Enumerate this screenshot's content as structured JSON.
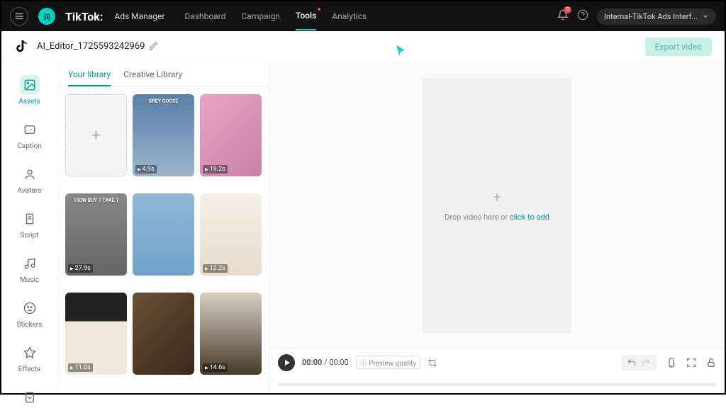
{
  "topnav": {
    "brand": "TikTok:",
    "brand_sub": "Ads Manager",
    "items": [
      "Dashboard",
      "Campaign",
      "Tools",
      "Analytics"
    ],
    "active_index": 2,
    "bell_badge": "0",
    "account_label": "Internal-TikTok Ads Interf...",
    "avatar_initial": "润"
  },
  "subheader": {
    "project_name": "AI_Editor_1725593242969",
    "export_label": "Export video"
  },
  "sidebar": {
    "items": [
      {
        "label": "Assets",
        "icon": "image"
      },
      {
        "label": "Caption",
        "icon": "caption"
      },
      {
        "label": "Avatars",
        "icon": "avatar"
      },
      {
        "label": "Script",
        "icon": "script"
      },
      {
        "label": "Music",
        "icon": "music"
      },
      {
        "label": "Stickers",
        "icon": "sticker"
      },
      {
        "label": "Effects",
        "icon": "effects"
      }
    ],
    "active_index": 0
  },
  "library": {
    "tabs": [
      "Your library",
      "Creative Library"
    ],
    "active_tab": 0,
    "assets": [
      {
        "duration": "",
        "type": "add"
      },
      {
        "duration": "4.9s",
        "bg": "linear-gradient(#5a7fa8,#9ab4cc)",
        "label": "GREY GOOSE"
      },
      {
        "duration": "19.2s",
        "bg": "linear-gradient(135deg,#e8a5c5,#c97fa8)"
      },
      {
        "duration": "27.9s",
        "bg": "linear-gradient(#888,#666)",
        "label": "150W BUY 1 TAKE 1"
      },
      {
        "duration": "",
        "bg": "linear-gradient(#8fb8d8,#6fa0c8)"
      },
      {
        "duration": "12.2s",
        "bg": "linear-gradient(#f5f0e8,#e8dcc8)"
      },
      {
        "duration": "11.0s",
        "bg": "linear-gradient(#222 0%,#222 35%,#f0e8d8 35%,#f0e8d8 100%)"
      },
      {
        "duration": "",
        "bg": "linear-gradient(135deg,#6a5038,#3a2818)"
      },
      {
        "duration": "14.6s",
        "bg": "linear-gradient(#d8d0c0,#4a3828)"
      }
    ]
  },
  "canvas": {
    "drop_text": "Drop video here or ",
    "drop_link": "click to add"
  },
  "timeline": {
    "current": "00:00",
    "total": "00:00",
    "quality_label": "Preview quality"
  }
}
